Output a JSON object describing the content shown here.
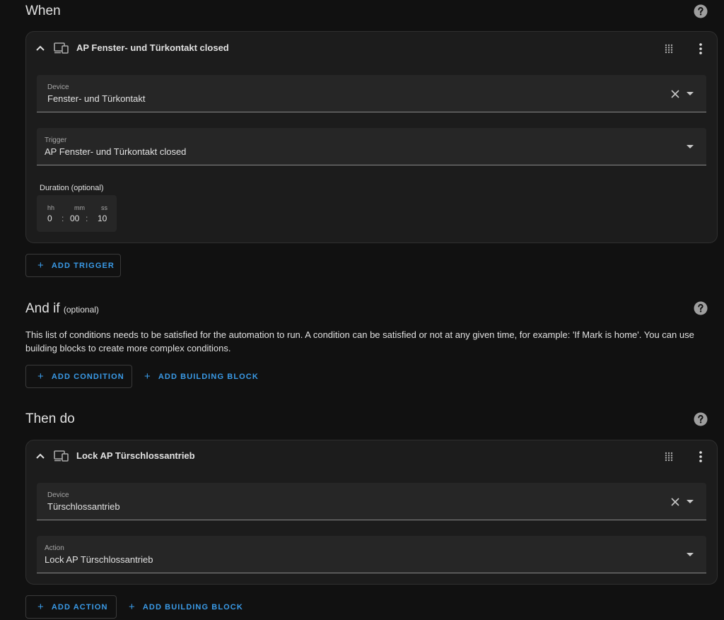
{
  "when": {
    "title": "When",
    "trigger_card": {
      "title": "AP Fenster- und Türkontakt closed",
      "device": {
        "label": "Device",
        "value": "Fenster- und Türkontakt"
      },
      "trigger": {
        "label": "Trigger",
        "value": "AP Fenster- und Türkontakt closed"
      },
      "duration": {
        "label": "Duration (optional)",
        "hh_label": "hh",
        "mm_label": "mm",
        "ss_label": "ss",
        "hh": "0",
        "mm": "00",
        "ss": "10",
        "sep": ":"
      }
    },
    "add_trigger": "ADD TRIGGER"
  },
  "and_if": {
    "title": "And if",
    "optional": "(optional)",
    "description": "This list of conditions needs to be satisfied for the automation to run. A condition can be satisfied or not at any given time, for example: 'If Mark is home'. You can use building blocks to create more complex conditions.",
    "add_condition": "ADD CONDITION",
    "add_building_block": "ADD BUILDING BLOCK"
  },
  "then_do": {
    "title": "Then do",
    "action_card": {
      "title": "Lock AP Türschlossantrieb",
      "device": {
        "label": "Device",
        "value": "Türschlossantrieb"
      },
      "action": {
        "label": "Action",
        "value": "Lock AP Türschlossantrieb"
      }
    },
    "add_action": "ADD ACTION",
    "add_building_block": "ADD BUILDING BLOCK"
  },
  "icons": {
    "plus": "+",
    "help": "question-circle",
    "chevron_up": "chevron-up",
    "device": "devices",
    "drag": "drag-handle",
    "menu": "dots-vertical",
    "clear": "close",
    "dropdown": "menu-down"
  },
  "colors": {
    "background": "#111111",
    "card": "#1c1c1c",
    "field": "#262626",
    "accent": "#3a9be8",
    "text": "#e1e1e1"
  }
}
